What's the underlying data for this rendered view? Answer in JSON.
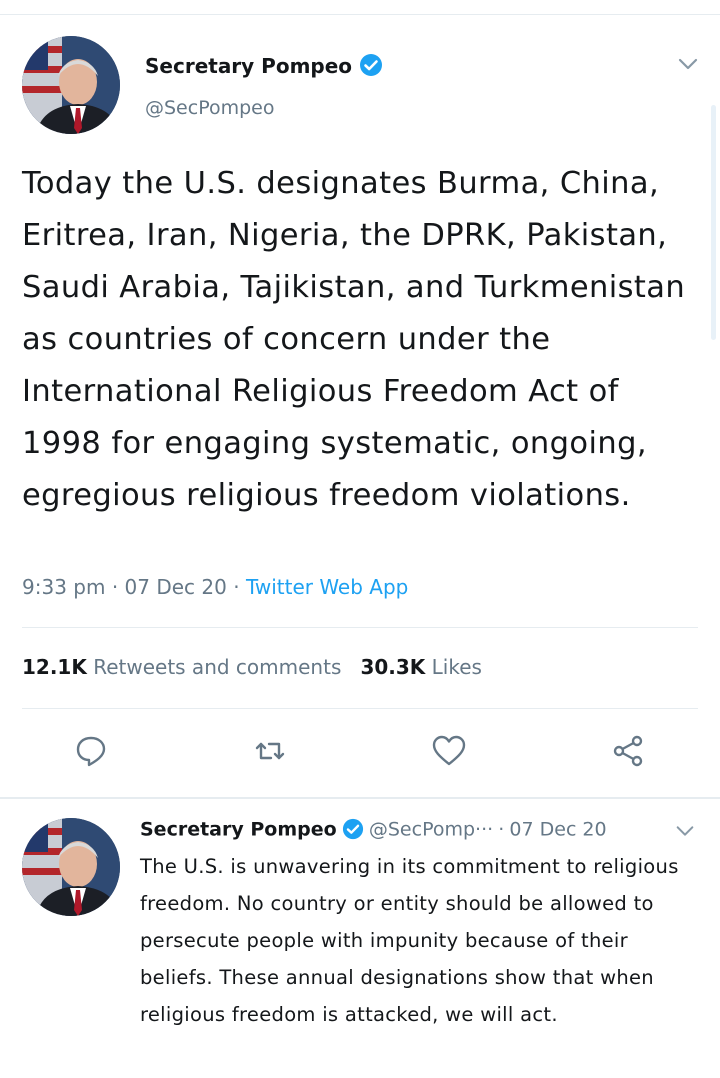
{
  "colors": {
    "accent": "#1da1f2",
    "muted": "#657786",
    "text": "#14171a",
    "divider": "#e6ecf0"
  },
  "tweet": {
    "display_name": "Secretary Pompeo",
    "handle": "@SecPompeo",
    "verified_icon": "verified-badge-icon",
    "text": "Today the U.S. designates Burma, China, Eritrea, Iran, Nigeria, the DPRK, Pakistan, Saudi Arabia, Tajikistan, and Turkmenistan as countries of concern under the International Religious Freedom Act of 1998 for engaging systematic, ongoing, egregious religious freedom violations.",
    "time": "9:33 pm",
    "date": "07 Dec 20",
    "source": "Twitter Web App",
    "retweets_count": "12.1K",
    "retweets_label": "Retweets and comments",
    "likes_count": "30.3K",
    "likes_label": "Likes",
    "actions": [
      "reply-icon",
      "retweet-icon",
      "like-icon",
      "share-icon"
    ]
  },
  "reply": {
    "display_name": "Secretary Pompeo",
    "handle": "@SecPomp···",
    "date": "07 Dec 20",
    "text": "The U.S. is unwavering in its commitment to religious freedom. No country or entity should be allowed to persecute people with impunity because of their beliefs. These annual designations show that when religious freedom is attacked, we will act."
  },
  "separators": {
    "dot": "·"
  }
}
